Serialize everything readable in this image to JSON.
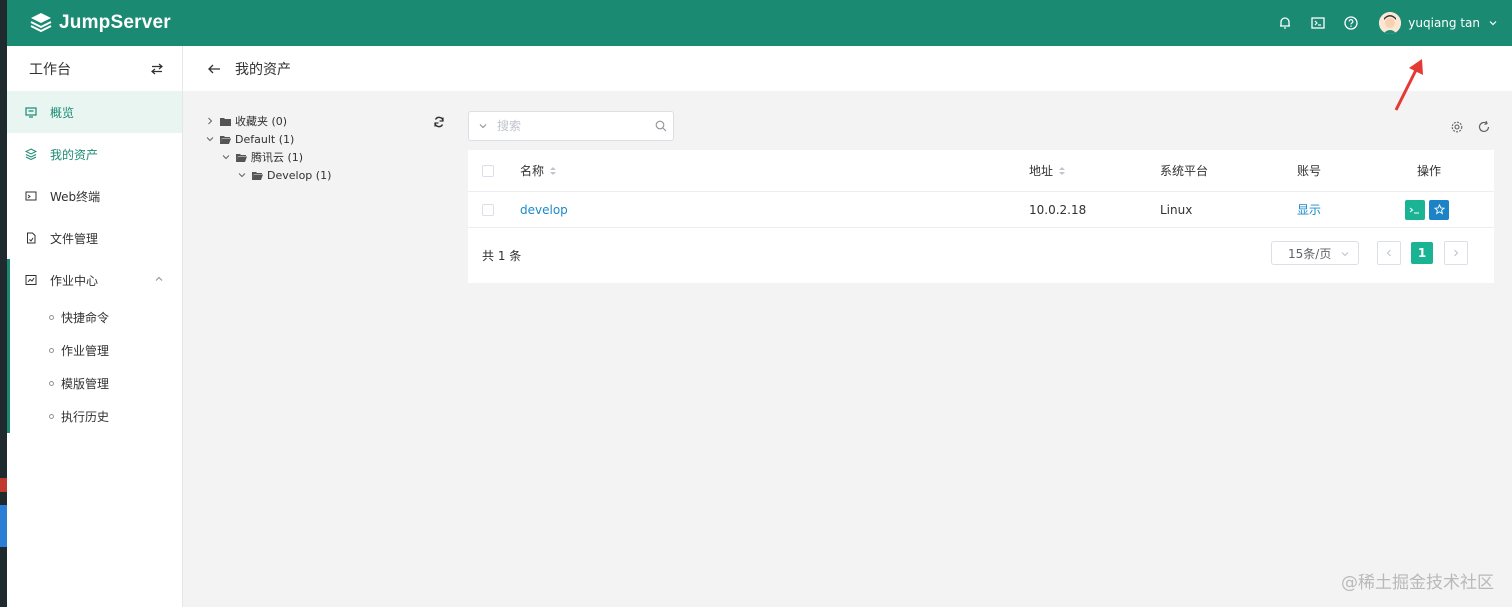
{
  "header": {
    "brand": "JumpServer",
    "user_name": "yuqiang tan",
    "icons": [
      "bell-icon",
      "terminal-icon",
      "help-icon"
    ],
    "accent": "#1a8a73"
  },
  "sidebar": {
    "title": "工作台",
    "items": [
      {
        "label": "概览",
        "icon": "monitor-icon"
      },
      {
        "label": "我的资产",
        "icon": "layers-icon"
      },
      {
        "label": "Web终端",
        "icon": "terminal-icon"
      },
      {
        "label": "文件管理",
        "icon": "file-icon"
      },
      {
        "label": "作业中心",
        "icon": "job-icon"
      }
    ],
    "sub_items": [
      "快捷命令",
      "作业管理",
      "模版管理",
      "执行历史"
    ]
  },
  "page": {
    "title": "我的资产"
  },
  "tree": {
    "nodes": [
      {
        "label": "收藏夹 (0)",
        "level": 0,
        "expanded": false
      },
      {
        "label": "Default (1)",
        "level": 0,
        "expanded": true
      },
      {
        "label": "腾讯云 (1)",
        "level": 1,
        "expanded": true
      },
      {
        "label": "Develop (1)",
        "level": 2,
        "expanded": true
      }
    ]
  },
  "search": {
    "placeholder": "搜索"
  },
  "table": {
    "columns": [
      "名称",
      "地址",
      "系统平台",
      "账号",
      "操作"
    ],
    "rows": [
      {
        "name": "develop",
        "address": "10.0.2.18",
        "platform": "Linux",
        "account": "显示"
      }
    ],
    "total": "共 1 条",
    "page_size": "15条/页",
    "current_page": "1"
  },
  "watermark": "@稀土掘金技术社区"
}
